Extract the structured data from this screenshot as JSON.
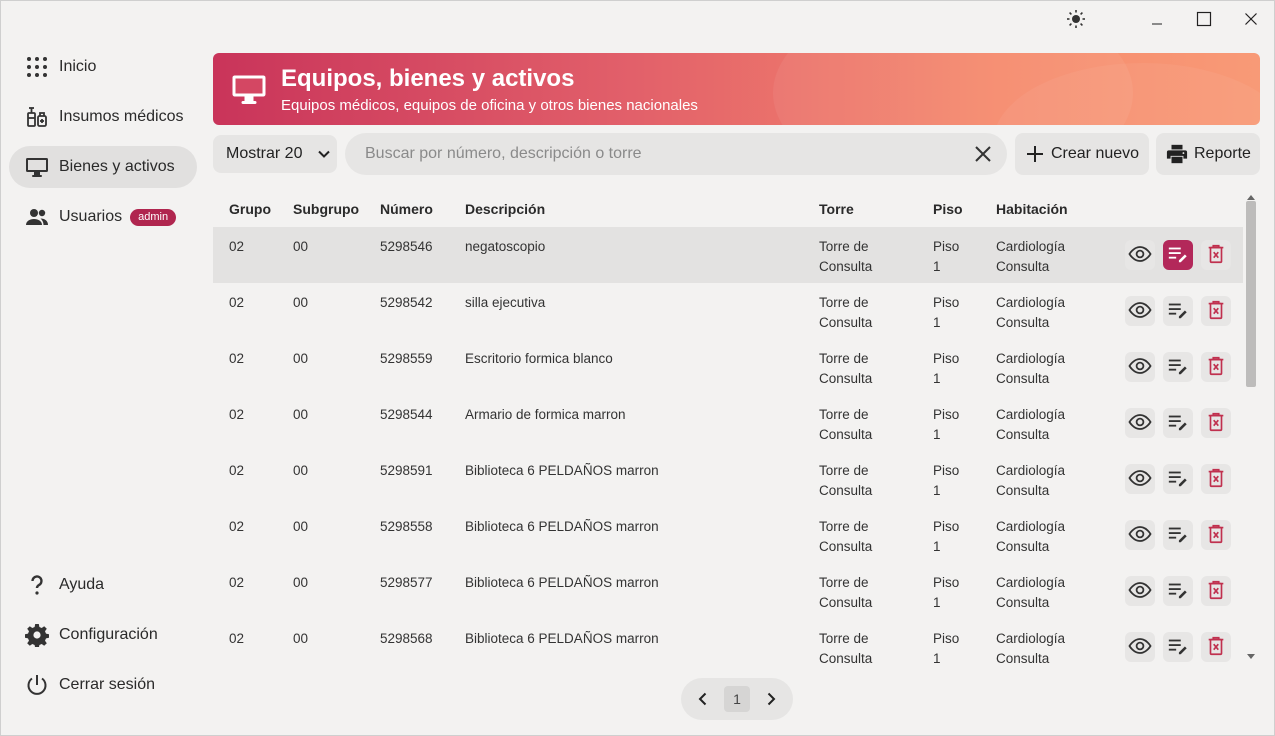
{
  "sidebar": {
    "items": [
      {
        "label": "Inicio",
        "icon": "grid-dots-icon"
      },
      {
        "label": "Insumos médicos",
        "icon": "medical-supplies-icon"
      },
      {
        "label": "Bienes y activos",
        "icon": "monitor-icon",
        "active": true
      },
      {
        "label": "Usuarios",
        "icon": "users-icon",
        "badge": "admin"
      }
    ],
    "bottom": [
      {
        "label": "Ayuda",
        "icon": "question-icon"
      },
      {
        "label": "Configuración",
        "icon": "gear-icon"
      },
      {
        "label": "Cerrar sesión",
        "icon": "power-icon"
      }
    ]
  },
  "header": {
    "title": "Equipos, bienes y activos",
    "subtitle": "Equipos médicos, equipos de oficina y otros bienes nacionales",
    "icon": "monitor-icon"
  },
  "toolbar": {
    "show_select": "Mostrar 20",
    "search_placeholder": "Buscar por número, descripción o torre",
    "search_value": "",
    "create_label": "Crear nuevo",
    "report_label": "Reporte"
  },
  "table": {
    "headers": {
      "grupo": "Grupo",
      "subgrupo": "Subgrupo",
      "numero": "Número",
      "descripcion": "Descripción",
      "torre": "Torre",
      "piso": "Piso",
      "habitacion": "Habitación"
    },
    "rows": [
      {
        "grupo": "02",
        "subgrupo": "00",
        "numero": "5298546",
        "descripcion": "negatoscopio",
        "torre_1": "Torre de",
        "torre_2": "Consulta",
        "piso_1": "Piso",
        "piso_2": "1",
        "hab_1": "Cardiología",
        "hab_2": "Consulta"
      },
      {
        "grupo": "02",
        "subgrupo": "00",
        "numero": "5298542",
        "descripcion": "silla ejecutiva",
        "torre_1": "Torre de",
        "torre_2": "Consulta",
        "piso_1": "Piso",
        "piso_2": "1",
        "hab_1": "Cardiología",
        "hab_2": "Consulta"
      },
      {
        "grupo": "02",
        "subgrupo": "00",
        "numero": "5298559",
        "descripcion": "Escritorio formica blanco",
        "torre_1": "Torre de",
        "torre_2": "Consulta",
        "piso_1": "Piso",
        "piso_2": "1",
        "hab_1": "Cardiología",
        "hab_2": "Consulta"
      },
      {
        "grupo": "02",
        "subgrupo": "00",
        "numero": "5298544",
        "descripcion": "Armario de formica marron",
        "torre_1": "Torre de",
        "torre_2": "Consulta",
        "piso_1": "Piso",
        "piso_2": "1",
        "hab_1": "Cardiología",
        "hab_2": "Consulta"
      },
      {
        "grupo": "02",
        "subgrupo": "00",
        "numero": "5298591",
        "descripcion": "Biblioteca 6 PELDAÑOS marron",
        "torre_1": "Torre de",
        "torre_2": "Consulta",
        "piso_1": "Piso",
        "piso_2": "1",
        "hab_1": "Cardiología",
        "hab_2": "Consulta"
      },
      {
        "grupo": "02",
        "subgrupo": "00",
        "numero": "5298558",
        "descripcion": "Biblioteca 6 PELDAÑOS marron",
        "torre_1": "Torre de",
        "torre_2": "Consulta",
        "piso_1": "Piso",
        "piso_2": "1",
        "hab_1": "Cardiología",
        "hab_2": "Consulta"
      },
      {
        "grupo": "02",
        "subgrupo": "00",
        "numero": "5298577",
        "descripcion": "Biblioteca 6 PELDAÑOS marron",
        "torre_1": "Torre de",
        "torre_2": "Consulta",
        "piso_1": "Piso",
        "piso_2": "1",
        "hab_1": "Cardiología",
        "hab_2": "Consulta"
      },
      {
        "grupo": "02",
        "subgrupo": "00",
        "numero": "5298568",
        "descripcion": "Biblioteca 6 PELDAÑOS marron",
        "torre_1": "Torre de",
        "torre_2": "Consulta",
        "piso_1": "Piso",
        "piso_2": "1",
        "hab_1": "Cardiología",
        "hab_2": "Consulta"
      }
    ]
  },
  "pagination": {
    "current_page": "1"
  },
  "colors": {
    "accent": "#b3285a",
    "delete": "#c0304e",
    "banner_start": "#c9345a",
    "banner_end": "#f89a77"
  }
}
